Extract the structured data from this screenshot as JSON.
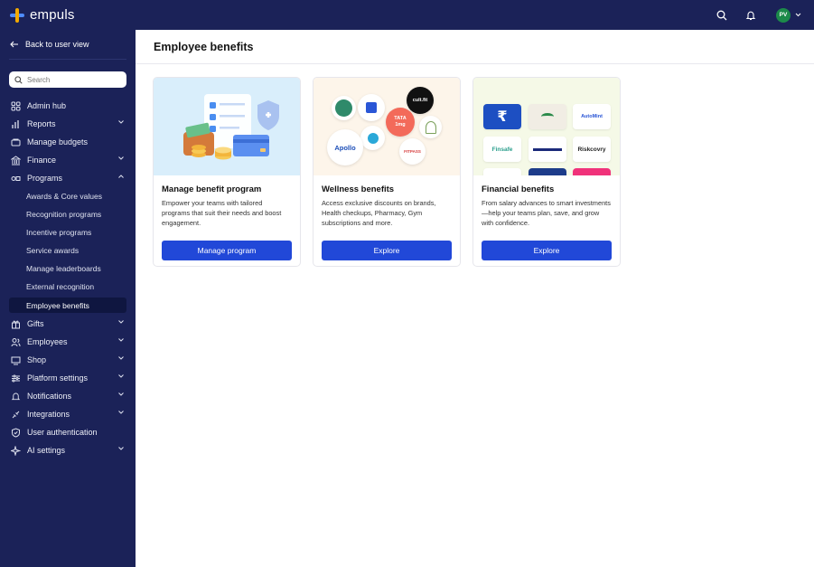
{
  "app": {
    "brand": "empuls",
    "user_initials": "PV"
  },
  "sidebar": {
    "back_label": "Back to user view",
    "search_placeholder": "Search",
    "items": [
      {
        "label": "Admin hub",
        "icon": "admin-hub-icon"
      },
      {
        "label": "Reports",
        "icon": "reports-icon"
      },
      {
        "label": "Manage budgets",
        "icon": "budget-icon"
      },
      {
        "label": "Finance",
        "icon": "finance-icon"
      },
      {
        "label": "Programs",
        "icon": "programs-icon"
      }
    ],
    "program_subitems": [
      "Awards & Core values",
      "Recognition programs",
      "Incentive programs",
      "Service awards",
      "Manage leaderboards",
      "External recognition",
      "Employee benefits"
    ],
    "lower_items": [
      {
        "label": "Gifts",
        "icon": "gift-icon"
      },
      {
        "label": "Employees",
        "icon": "employees-icon"
      },
      {
        "label": "Shop",
        "icon": "shop-icon"
      },
      {
        "label": "Platform settings",
        "icon": "settings-icon"
      },
      {
        "label": "Notifications",
        "icon": "bell-icon"
      },
      {
        "label": "Integrations",
        "icon": "integrations-icon"
      },
      {
        "label": "User authentication",
        "icon": "shield-icon"
      },
      {
        "label": "AI settings",
        "icon": "sparkle-icon"
      }
    ]
  },
  "main": {
    "title": "Employee benefits",
    "cards": [
      {
        "title": "Manage benefit program",
        "description": "Empower your teams with tailored programs that suit their needs and boost engagement.",
        "button": "Manage program"
      },
      {
        "title": "Wellness benefits",
        "description": "Access exclusive discounts on brands, Health checkups, Pharmacy, Gym subscriptions and more.",
        "button": "Explore"
      },
      {
        "title": "Financial benefits",
        "description": "From salary advances to smart investments—help your teams plan, save, and grow with confidence.",
        "button": "Explore"
      }
    ],
    "wellness_logos": [
      "cult.fit",
      "TATA 1mg",
      "Apollo",
      "FITPASS"
    ],
    "financial_logos": [
      "AutoMint",
      "Finsafe",
      "Riskcovry"
    ]
  },
  "colors": {
    "sidebar_bg": "#1b2258",
    "button_blue": "#2148d8",
    "avatar_green": "#1c8a4a"
  }
}
